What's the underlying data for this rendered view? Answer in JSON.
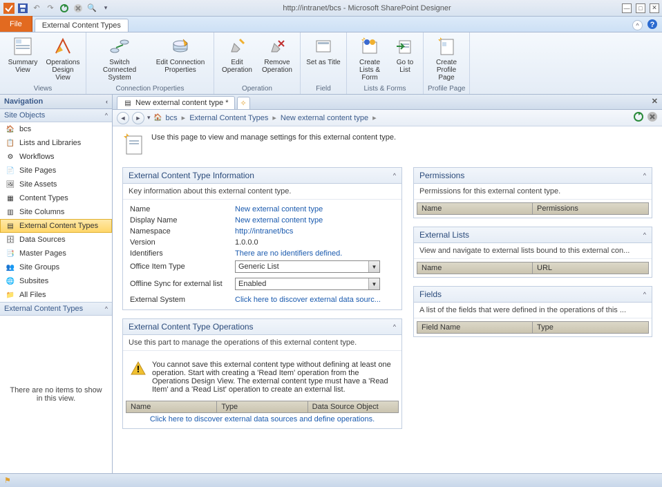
{
  "window": {
    "title": "http://intranet/bcs - Microsoft SharePoint Designer"
  },
  "tabs": {
    "file": "File",
    "active": "External Content Types"
  },
  "ribbon": {
    "views": {
      "label": "Views",
      "summary_view": "Summary View",
      "design_view": "Operations Design View"
    },
    "connection": {
      "label": "Connection Properties",
      "switch": "Switch Connected System",
      "edit": "Edit Connection Properties"
    },
    "operation": {
      "label": "Operation",
      "edit": "Edit Operation",
      "remove": "Remove Operation"
    },
    "field": {
      "label": "Field",
      "set_as_title": "Set as Title"
    },
    "lists_forms": {
      "label": "Lists & Forms",
      "create": "Create Lists & Form",
      "goto": "Go to List"
    },
    "profile": {
      "label": "Profile Page",
      "create": "Create Profile Page"
    }
  },
  "nav": {
    "header": "Navigation",
    "section": "Site Objects",
    "items": [
      "bcs",
      "Lists and Libraries",
      "Workflows",
      "Site Pages",
      "Site Assets",
      "Content Types",
      "Site Columns",
      "External Content Types",
      "Data Sources",
      "Master Pages",
      "Site Groups",
      "Subsites",
      "All Files"
    ],
    "bottom_header": "External Content Types",
    "empty_text": "There are no items to show in this view."
  },
  "doc_tab": "New external content type *",
  "breadcrumb": {
    "home": "bcs",
    "part1": "External Content Types",
    "part2": "New external content type"
  },
  "page": {
    "intro": "Use this page to view and manage settings for this external content type."
  },
  "info_panel": {
    "title": "External Content Type Information",
    "desc": "Key information about this external content type.",
    "rows": {
      "name_l": "Name",
      "name_v": "New external content type",
      "display_l": "Display Name",
      "display_v": "New external content type",
      "ns_l": "Namespace",
      "ns_v": "http://intranet/bcs",
      "ver_l": "Version",
      "ver_v": "1.0.0.0",
      "id_l": "Identifiers",
      "id_v": "There are no identifiers defined.",
      "office_l": "Office Item Type",
      "office_v": "Generic List",
      "sync_l": "Offline Sync for external list",
      "sync_v": "Enabled",
      "ext_l": "External System",
      "ext_v": "Click here to discover external data sourc..."
    }
  },
  "ops_panel": {
    "title": "External Content Type Operations",
    "desc": "Use this part to manage the operations of this external content type.",
    "warning": "You cannot save this external content type without defining at least one operation. Start with creating a 'Read Item' operation from the Operations Design View. The external content type must have a 'Read Item' and a 'Read List' operation to create an external list.",
    "cols": {
      "name": "Name",
      "type": "Type",
      "dso": "Data Source Object"
    },
    "link": "Click here to discover external data sources and define operations."
  },
  "perm_panel": {
    "title": "Permissions",
    "desc": "Permissions for this external content type.",
    "cols": {
      "name": "Name",
      "perm": "Permissions"
    }
  },
  "lists_panel": {
    "title": "External Lists",
    "desc": "View and navigate to external lists bound to this external con...",
    "cols": {
      "name": "Name",
      "url": "URL"
    }
  },
  "fields_panel": {
    "title": "Fields",
    "desc": "A list of the fields that were defined in the operations of this ...",
    "cols": {
      "fn": "Field Name",
      "type": "Type"
    }
  }
}
